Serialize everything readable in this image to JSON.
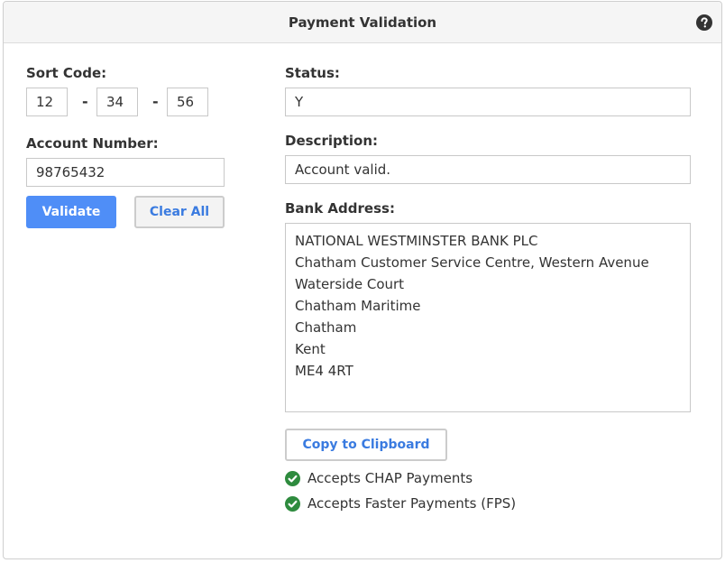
{
  "header": {
    "title": "Payment Validation",
    "help_icon": "question-circle-icon"
  },
  "form": {
    "sort_code_label": "Sort Code:",
    "sort_code": [
      "12",
      "34",
      "56"
    ],
    "separator": "-",
    "account_number_label": "Account Number:",
    "account_number": "98765432",
    "validate_label": "Validate",
    "clear_label": "Clear All"
  },
  "result": {
    "status_label": "Status:",
    "status": "Y",
    "description_label": "Description:",
    "description": "Account valid.",
    "bank_address_label": "Bank Address:",
    "bank_address_lines": [
      "NATIONAL WESTMINSTER BANK PLC",
      "Chatham Customer Service Centre, Western Avenue",
      "Waterside Court",
      "Chatham Maritime",
      "Chatham",
      "Kent",
      "ME4 4RT"
    ],
    "copy_label": "Copy to Clipboard",
    "features": [
      {
        "icon": "check-circle-icon",
        "label": "Accepts CHAP Payments"
      },
      {
        "icon": "check-circle-icon",
        "label": "Accepts Faster Payments (FPS)"
      }
    ]
  },
  "colors": {
    "primary": "#4f8ef7",
    "link": "#3a7be0",
    "success": "#2e8b3e"
  }
}
